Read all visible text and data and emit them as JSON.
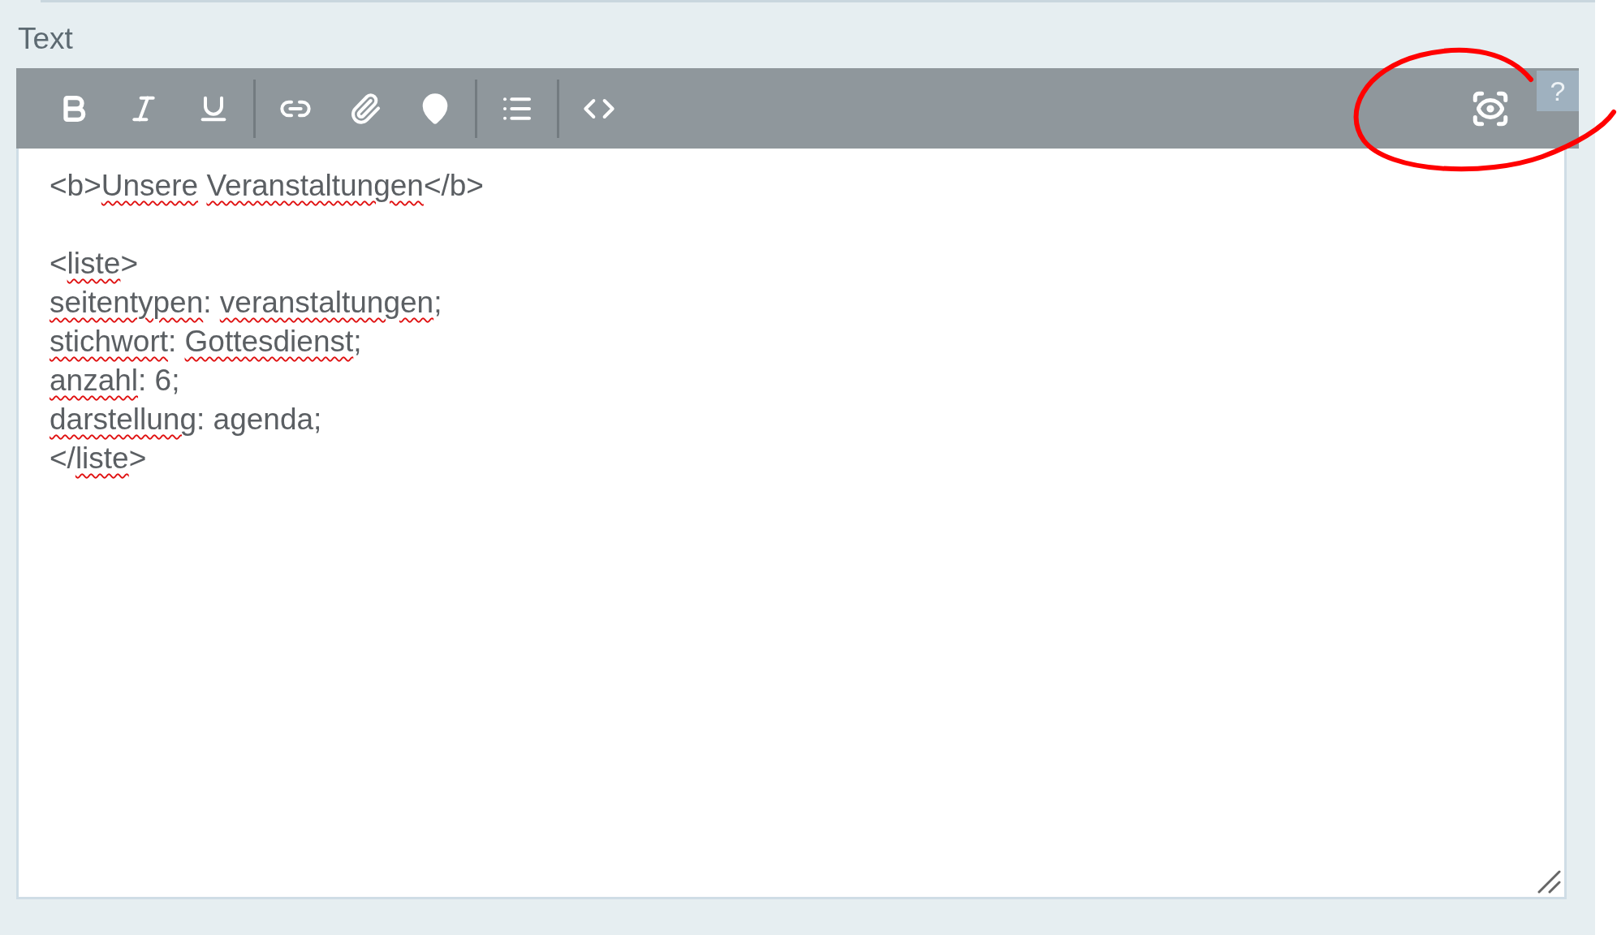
{
  "field": {
    "label": "Text"
  },
  "toolbar": {
    "groups": [
      [
        {
          "kind": "bold"
        },
        {
          "kind": "italic"
        },
        {
          "kind": "underline"
        }
      ],
      [
        {
          "kind": "link"
        },
        {
          "kind": "attachment"
        },
        {
          "kind": "location"
        }
      ],
      [
        {
          "kind": "list"
        }
      ],
      [
        {
          "kind": "code"
        }
      ]
    ],
    "preview": {
      "kind": "preview"
    },
    "help": {
      "label": "?"
    }
  },
  "editor": {
    "lines": [
      {
        "gap_before": false,
        "segments": [
          {
            "text": "<b>",
            "misspelled": false
          },
          {
            "text": "Unsere",
            "misspelled": true
          },
          {
            "text": "Veranstaltungen",
            "misspelled": true,
            "space_before": true
          },
          {
            "text": "</b>",
            "misspelled": false
          }
        ]
      },
      {
        "gap_before": true,
        "segments": [
          {
            "text": "<",
            "misspelled": false
          },
          {
            "text": "liste",
            "misspelled": true
          },
          {
            "text": ">",
            "misspelled": false
          }
        ]
      },
      {
        "gap_before": false,
        "segments": [
          {
            "text": "seitentypen",
            "misspelled": true
          },
          {
            "text": ": ",
            "misspelled": false
          },
          {
            "text": "veranstaltungen",
            "misspelled": true
          },
          {
            "text": ";",
            "misspelled": false
          }
        ]
      },
      {
        "gap_before": false,
        "segments": [
          {
            "text": "stichwort",
            "misspelled": true
          },
          {
            "text": ": ",
            "misspelled": false
          },
          {
            "text": "Gottesdienst",
            "misspelled": true
          },
          {
            "text": ";",
            "misspelled": false
          }
        ]
      },
      {
        "gap_before": false,
        "segments": [
          {
            "text": "anzahl",
            "misspelled": true
          },
          {
            "text": ": 6;",
            "misspelled": false
          }
        ]
      },
      {
        "gap_before": false,
        "segments": [
          {
            "text": "darstellung",
            "misspelled": true
          },
          {
            "text": ": agenda;",
            "misspelled": false
          }
        ]
      },
      {
        "gap_before": false,
        "segments": [
          {
            "text": "</",
            "misspelled": false
          },
          {
            "text": "liste",
            "misspelled": true
          },
          {
            "text": ">",
            "misspelled": false
          }
        ]
      }
    ]
  }
}
